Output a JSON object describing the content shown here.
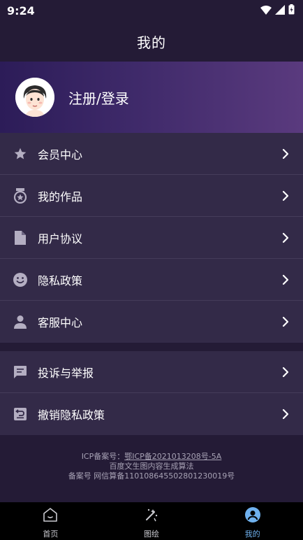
{
  "status_bar": {
    "time": "9:24"
  },
  "header": {
    "title": "我的"
  },
  "profile": {
    "login_label": "注册/登录"
  },
  "menu_group_1": [
    {
      "label": "会员中心",
      "icon": "star-icon"
    },
    {
      "label": "我的作品",
      "icon": "badge-icon"
    },
    {
      "label": "用户协议",
      "icon": "document-icon"
    },
    {
      "label": "隐私政策",
      "icon": "smiley-icon"
    },
    {
      "label": "客服中心",
      "icon": "person-icon"
    }
  ],
  "menu_group_2": [
    {
      "label": "投诉与举报",
      "icon": "chat-icon"
    },
    {
      "label": "撤销隐私政策",
      "icon": "revoke-icon"
    }
  ],
  "footer": {
    "icp_prefix": "ICP备案号：",
    "icp_number": "鄂ICP备2021013208号-5A",
    "line2": "百度文生图内容生成算法",
    "line3": "备案号 网信算备110108645502801230019号"
  },
  "tabs": [
    {
      "label": "首页",
      "icon": "home-icon",
      "active": false
    },
    {
      "label": "图绘",
      "icon": "magic-wand-icon",
      "active": false
    },
    {
      "label": "我的",
      "icon": "profile-icon",
      "active": true
    }
  ],
  "colors": {
    "background": "#241b36",
    "menu_bg": "#332a48",
    "banner_start": "#2c1c58",
    "banner_end": "#5a3a7e",
    "active_tab": "#6fb1ee"
  }
}
